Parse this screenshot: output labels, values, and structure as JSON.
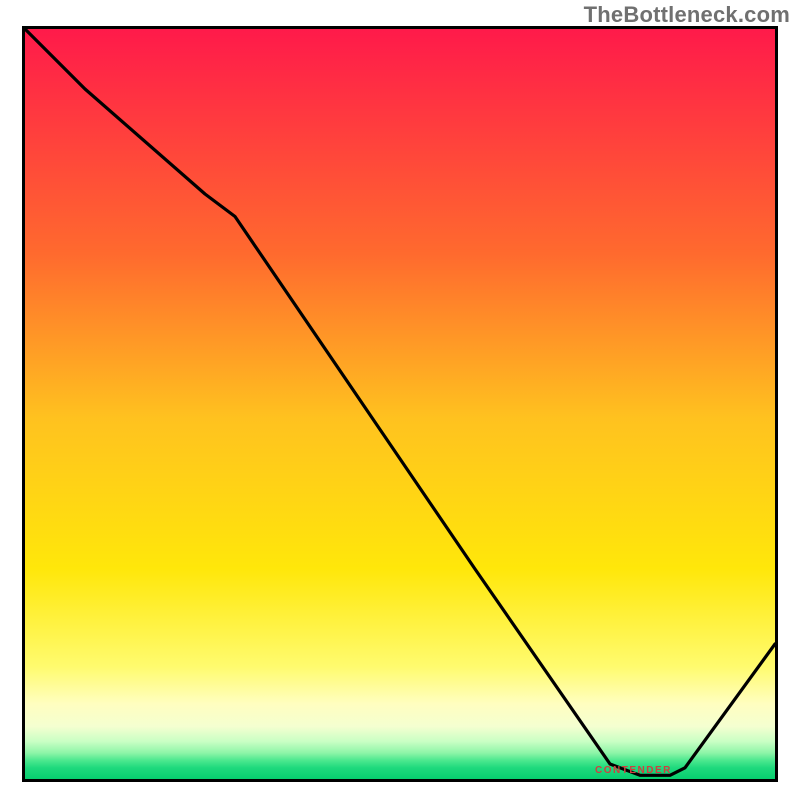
{
  "watermark": "TheBottleneck.com",
  "annotation_label": "CONTENDER",
  "chart_data": {
    "type": "line",
    "title": "",
    "xlabel": "",
    "ylabel": "",
    "xlim": [
      0,
      100
    ],
    "ylim": [
      0,
      100
    ],
    "grid": false,
    "series": [
      {
        "name": "curve",
        "x": [
          0,
          8,
          24,
          28,
          60,
          78,
          82,
          86,
          88,
          100
        ],
        "values": [
          100,
          92,
          78,
          75,
          28,
          2,
          0.5,
          0.5,
          1.5,
          18
        ]
      }
    ],
    "annotation": {
      "x": 82,
      "y": 0.8,
      "text": "CONTENDER"
    },
    "background": {
      "type": "vertical-gradient",
      "stops": [
        {
          "pos": 0,
          "color": "#ff1a4a"
        },
        {
          "pos": 0.3,
          "color": "#ff6a2e"
        },
        {
          "pos": 0.52,
          "color": "#ffc21f"
        },
        {
          "pos": 0.72,
          "color": "#ffe70a"
        },
        {
          "pos": 0.85,
          "color": "#fffb6e"
        },
        {
          "pos": 0.9,
          "color": "#fffec0"
        },
        {
          "pos": 0.93,
          "color": "#f4ffd0"
        },
        {
          "pos": 0.95,
          "color": "#c9ffc4"
        },
        {
          "pos": 0.965,
          "color": "#8ff5a8"
        },
        {
          "pos": 0.975,
          "color": "#4de88f"
        },
        {
          "pos": 0.985,
          "color": "#1fd97d"
        },
        {
          "pos": 1.0,
          "color": "#07cf6f"
        }
      ]
    }
  }
}
